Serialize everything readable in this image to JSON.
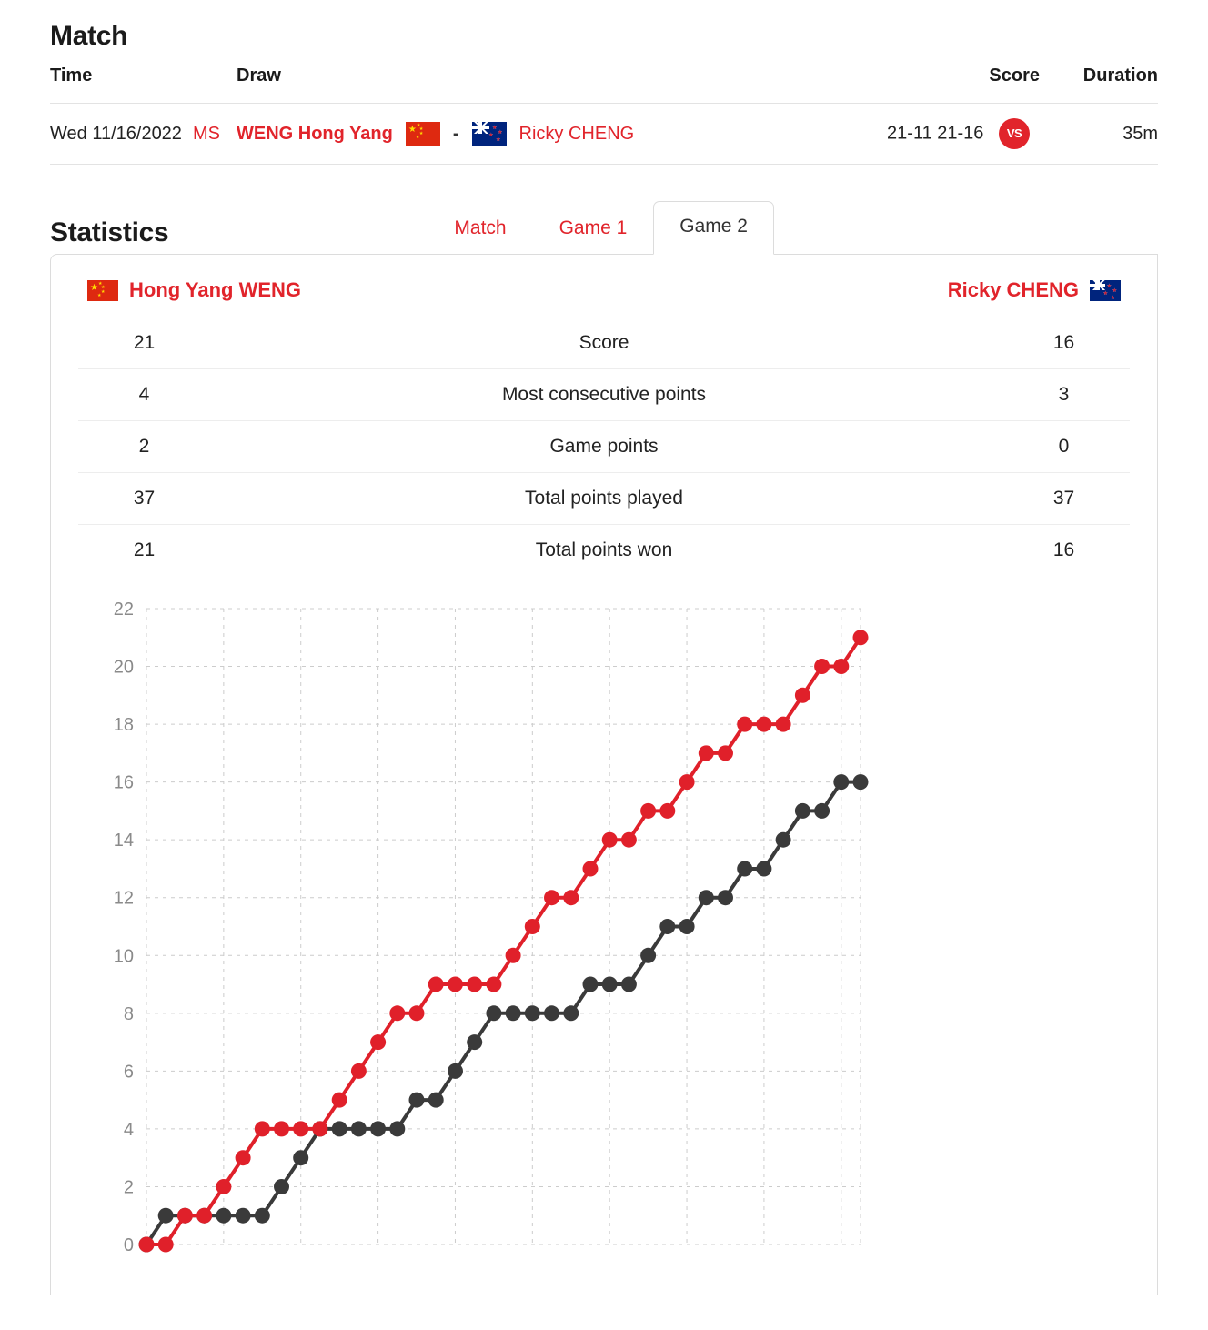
{
  "match": {
    "title": "Match",
    "columns": {
      "time": "Time",
      "draw": "Draw",
      "score": "Score",
      "duration": "Duration"
    },
    "row": {
      "date": "Wed 11/16/2022",
      "draw_code": "MS",
      "player1": "WENG Hong Yang",
      "player1_flag": "cn-flag-icon",
      "separator": "-",
      "player2": "Ricky CHENG",
      "player2_flag": "nz-flag-icon",
      "score": "21-11 21-16",
      "vs_badge": "VS",
      "duration": "35m"
    }
  },
  "statistics": {
    "title": "Statistics",
    "tabs": [
      {
        "label": "Match",
        "active": false
      },
      {
        "label": "Game 1",
        "active": false
      },
      {
        "label": "Game 2",
        "active": true
      }
    ],
    "players": {
      "left": {
        "name": "Hong Yang WENG",
        "flag": "cn-flag-icon"
      },
      "right": {
        "name": "Ricky CHENG",
        "flag": "nz-flag-icon"
      }
    },
    "rows": [
      {
        "label": "Score",
        "left": "21",
        "right": "16"
      },
      {
        "label": "Most consecutive points",
        "left": "4",
        "right": "3"
      },
      {
        "label": "Game points",
        "left": "2",
        "right": "0"
      },
      {
        "label": "Total points played",
        "left": "37",
        "right": "37"
      },
      {
        "label": "Total points won",
        "left": "21",
        "right": "16"
      }
    ]
  },
  "colors": {
    "accent_red": "#e1242b",
    "series_red": "#e0202a",
    "series_dark": "#3a3a3a",
    "grid": "#cccccc",
    "text": "#222222",
    "axis_label": "#8a8a8a"
  },
  "chart_data": {
    "type": "line",
    "title": "",
    "xlabel": "",
    "ylabel": "",
    "ylim": [
      0,
      22
    ],
    "yticks": [
      0,
      2,
      4,
      6,
      8,
      10,
      12,
      14,
      16,
      18,
      20,
      22
    ],
    "xlim": [
      0,
      37
    ],
    "grid": true,
    "legend": "none",
    "x": [
      0,
      1,
      2,
      3,
      4,
      5,
      6,
      7,
      8,
      9,
      10,
      11,
      12,
      13,
      14,
      15,
      16,
      17,
      18,
      19,
      20,
      21,
      22,
      23,
      24,
      25,
      26,
      27,
      28,
      29,
      30,
      31,
      32,
      33,
      34,
      35,
      36,
      37
    ],
    "series": [
      {
        "name": "Hong Yang WENG",
        "color": "#e0202a",
        "values": [
          0,
          0,
          1,
          1,
          2,
          3,
          4,
          4,
          4,
          4,
          5,
          6,
          7,
          8,
          8,
          9,
          9,
          9,
          9,
          10,
          11,
          12,
          12,
          13,
          14,
          14,
          15,
          15,
          16,
          17,
          17,
          18,
          18,
          18,
          19,
          20,
          20,
          21
        ]
      },
      {
        "name": "Ricky CHENG",
        "color": "#3a3a3a",
        "values": [
          0,
          1,
          1,
          1,
          1,
          1,
          1,
          2,
          3,
          4,
          4,
          4,
          4,
          4,
          5,
          5,
          6,
          7,
          8,
          8,
          8,
          8,
          8,
          9,
          9,
          9,
          10,
          11,
          11,
          12,
          12,
          13,
          13,
          14,
          15,
          15,
          16,
          16
        ]
      }
    ]
  }
}
